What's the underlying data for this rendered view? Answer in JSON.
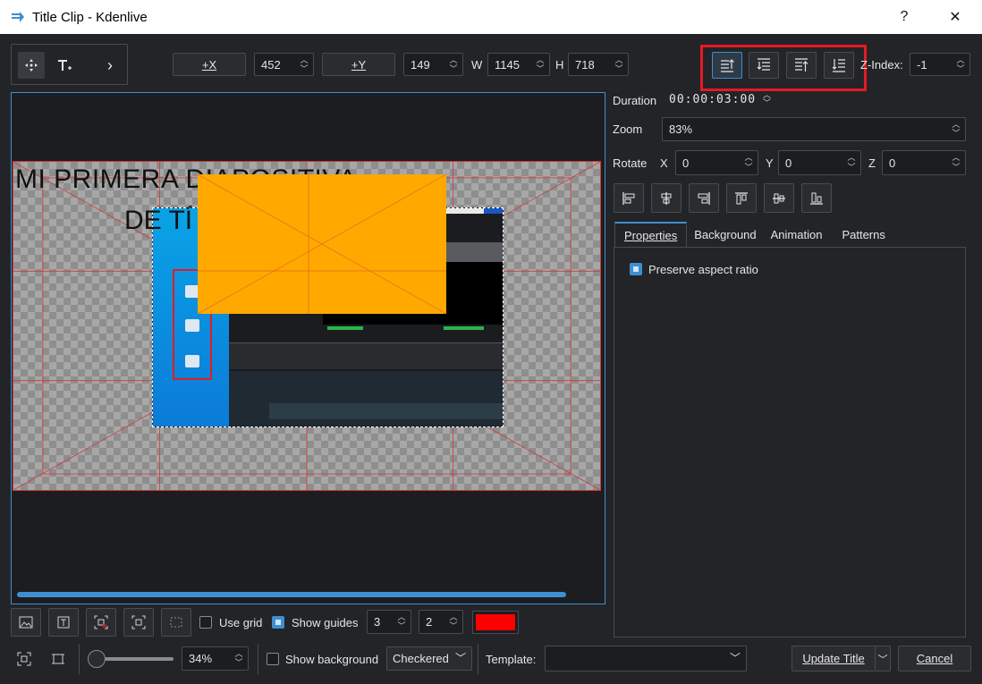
{
  "window": {
    "title": "Title Clip - Kdenlive",
    "help_label": "?",
    "close_label": "✕"
  },
  "toolbar": {
    "chevron": "›",
    "add_x_label": "+X",
    "x_value": "452",
    "add_y_label": "+Y",
    "y_value": "149",
    "w_label": "W",
    "w_value": "1145",
    "h_label": "H",
    "h_value": "718",
    "zindex_label": "Z-Index:",
    "zindex_value": "-1"
  },
  "properties": {
    "duration_label": "Duration",
    "duration_value": "00:00:03:00",
    "zoom_label": "Zoom",
    "zoom_value": "83%",
    "rotate_label": "Rotate",
    "rx_label": "X",
    "rx_value": "0",
    "ry_label": "Y",
    "ry_value": "0",
    "rz_label": "Z",
    "rz_value": "0"
  },
  "tabs": [
    {
      "label": "Properties"
    },
    {
      "label": "Background"
    },
    {
      "label": "Animation"
    },
    {
      "label": "Patterns"
    }
  ],
  "tab_panel": {
    "preserve_aspect_label": "Preserve aspect ratio",
    "preserve_aspect_checked": true
  },
  "canvas": {
    "title_line_1": "MI PRIMERA DIAPOSITIVA",
    "title_line_2": "DE TÍ",
    "rect_color": "#ffa900",
    "guide_color": "#d23a3a"
  },
  "bottom_bar": {
    "use_grid_label": "Use grid",
    "use_grid_checked": false,
    "show_guides_label": "Show guides",
    "show_guides_checked": true,
    "guides_h_value": "3",
    "guides_v_value": "2",
    "guide_color": "#ff0000"
  },
  "footer": {
    "zoom_value": "34%",
    "show_background_label": "Show background",
    "background_mode": "Checkered",
    "template_label": "Template:",
    "template_value": "",
    "update_title_label": "Update Title",
    "cancel_label": "Cancel"
  },
  "colors": {
    "accent": "#3d8fd1",
    "highlight": "#e31b23",
    "panel_bg": "#232427"
  }
}
